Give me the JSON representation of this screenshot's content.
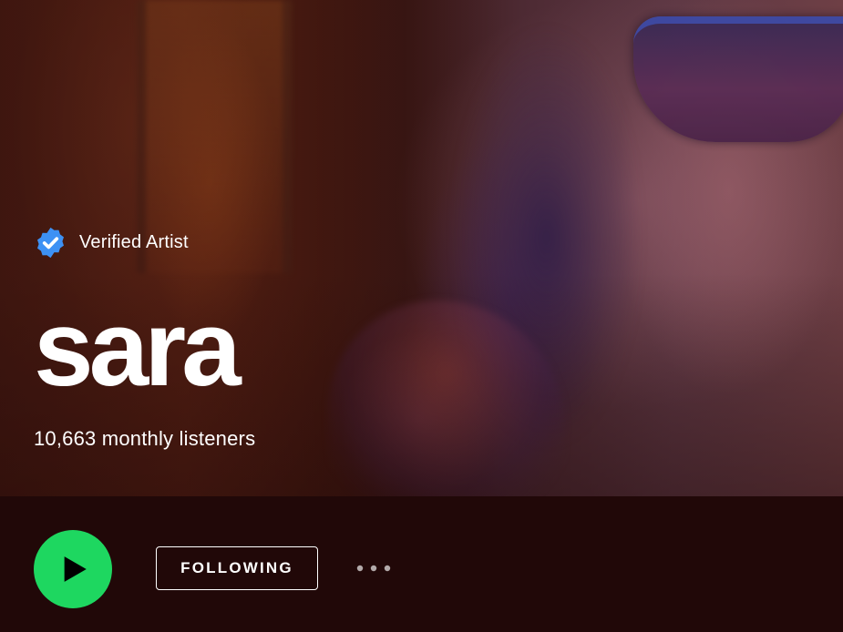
{
  "hero": {
    "verified_label": "Verified Artist",
    "artist_name": "sara",
    "monthly_listeners": "10,663 monthly listeners",
    "background_image": "artist-photo"
  },
  "actions": {
    "play_icon": "play-icon",
    "follow_label": "FOLLOWING",
    "more_icon": "more-horizontal-icon"
  },
  "colors": {
    "accent_green": "#1ed760",
    "verified_blue": "#3d91f4",
    "action_bar_bg": "#210808",
    "text": "#ffffff"
  }
}
